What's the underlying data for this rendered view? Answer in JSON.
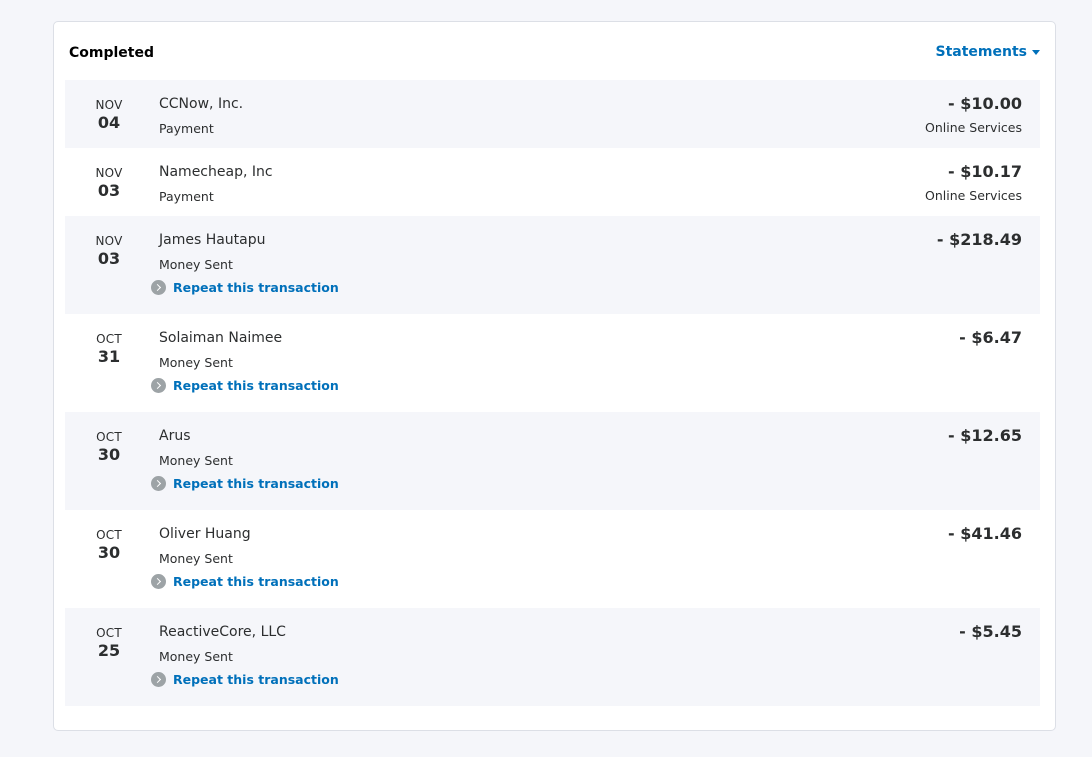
{
  "section": {
    "title": "Completed",
    "statements_label": "Statements"
  },
  "transactions": [
    {
      "month": "NOV",
      "day": "04",
      "name": "CCNow, Inc.",
      "type": "Payment",
      "amount": "- $10.00",
      "category": "Online Services"
    },
    {
      "month": "NOV",
      "day": "03",
      "name": "Namecheap, Inc",
      "type": "Payment",
      "amount": "- $10.17",
      "category": "Online Services"
    },
    {
      "month": "NOV",
      "day": "03",
      "name": "James Hautapu",
      "type": "Money Sent",
      "amount": "- $218.49",
      "repeat_label": "Repeat this transaction"
    },
    {
      "month": "OCT",
      "day": "31",
      "name": "Solaiman Naimee",
      "type": "Money Sent",
      "amount": "- $6.47",
      "repeat_label": "Repeat this transaction"
    },
    {
      "month": "OCT",
      "day": "30",
      "name": "Arus",
      "type": "Money Sent",
      "amount": "- $12.65",
      "repeat_label": "Repeat this transaction"
    },
    {
      "month": "OCT",
      "day": "30",
      "name": "Oliver Huang",
      "type": "Money Sent",
      "amount": "- $41.46",
      "repeat_label": "Repeat this transaction"
    },
    {
      "month": "OCT",
      "day": "25",
      "name": "ReactiveCore, LLC",
      "type": "Money Sent",
      "amount": "- $5.45",
      "repeat_label": "Repeat this transaction"
    }
  ],
  "colors": {
    "link": "#0070ba",
    "row_shade": "#f5f6fa",
    "text": "#2c2e2f",
    "repeat_icon": "#9da3a6"
  }
}
